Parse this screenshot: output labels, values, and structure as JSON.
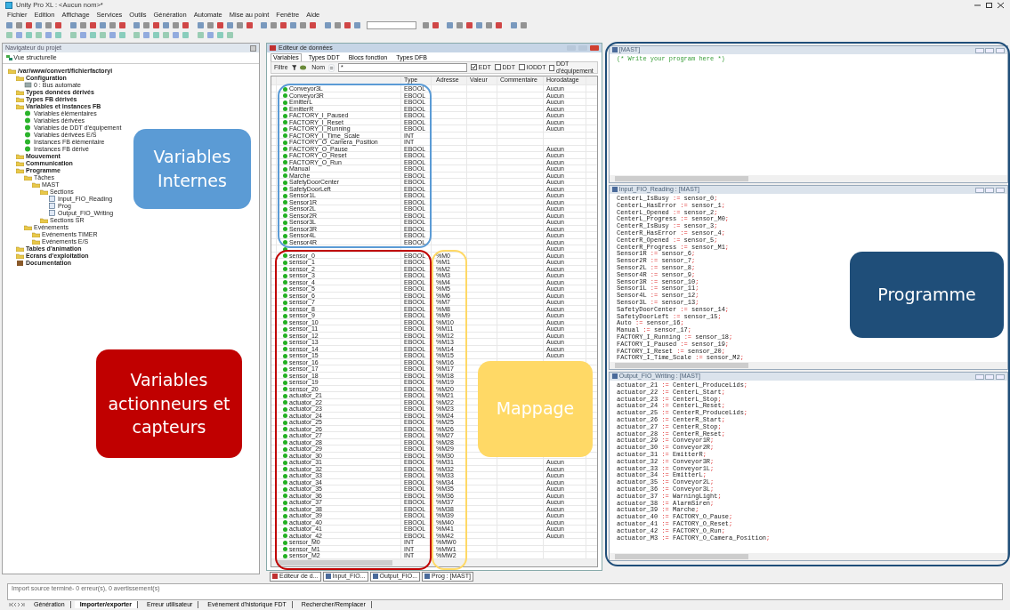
{
  "window": {
    "title": "Unity Pro XL : <Aucun nom>*"
  },
  "menu": [
    "Fichier",
    "Edition",
    "Affichage",
    "Services",
    "Outils",
    "Génération",
    "Automate",
    "Mise au point",
    "Fenêtre",
    "Aide"
  ],
  "project_browser": {
    "title": "Navigateur du projet",
    "view_tab": "Vue structurelle",
    "tree": [
      {
        "label": "/var/www/convert/fichierfactoryi",
        "kind": "folder",
        "children": [
          {
            "label": "Configuration",
            "kind": "folder",
            "children": [
              {
                "label": "0 : Bus automate",
                "kind": "device"
              }
            ]
          },
          {
            "label": "Types données dérivés",
            "kind": "folder"
          },
          {
            "label": "Types FB dérivés",
            "kind": "folder"
          },
          {
            "label": "Variables et instances FB",
            "kind": "folder",
            "children": [
              {
                "label": "Variables élémentaires",
                "kind": "variable"
              },
              {
                "label": "Variables dérivées",
                "kind": "variable"
              },
              {
                "label": "Variables de DDT d'équipement",
                "kind": "variable"
              },
              {
                "label": "Variables dérivées E/S",
                "kind": "variable"
              },
              {
                "label": "Instances FB élémentaire",
                "kind": "variable"
              },
              {
                "label": "Instances FB dérivé",
                "kind": "variable"
              }
            ]
          },
          {
            "label": "Mouvement",
            "kind": "folder"
          },
          {
            "label": "Communication",
            "kind": "folder"
          },
          {
            "label": "Programme",
            "kind": "folder",
            "children": [
              {
                "label": "Tâches",
                "kind": "folder",
                "children": [
                  {
                    "label": "MAST",
                    "kind": "folder",
                    "children": [
                      {
                        "label": "Sections",
                        "kind": "folder",
                        "children": [
                          {
                            "label": "Input_FIO_Reading",
                            "kind": "section"
                          },
                          {
                            "label": "Prog",
                            "kind": "section"
                          },
                          {
                            "label": "Output_FIO_Writing",
                            "kind": "section"
                          }
                        ]
                      },
                      {
                        "label": "Sections SR",
                        "kind": "folder"
                      }
                    ]
                  }
                ]
              },
              {
                "label": "Evénements",
                "kind": "folder",
                "children": [
                  {
                    "label": "Evénements TIMER",
                    "kind": "folder"
                  },
                  {
                    "label": "Evénements E/S",
                    "kind": "folder"
                  }
                ]
              }
            ]
          },
          {
            "label": "Tables d'animation",
            "kind": "folder"
          },
          {
            "label": "Ecrans d'exploitation",
            "kind": "folder"
          },
          {
            "label": "Documentation",
            "kind": "document"
          }
        ]
      }
    ]
  },
  "data_editor": {
    "title": "Editeur de données",
    "tabs": [
      {
        "label": "Variables",
        "selected": true
      },
      {
        "label": "Types DDT",
        "selected": false
      },
      {
        "label": "Blocs fonction",
        "selected": false
      },
      {
        "label": "Types DFB",
        "selected": false
      }
    ],
    "filter": {
      "label": "Filtre",
      "name_label": "Nom",
      "operator": "=",
      "value": "*",
      "options": [
        {
          "label": "EDT",
          "checked": true
        },
        {
          "label": "DDT",
          "checked": false
        },
        {
          "label": "IODDT",
          "checked": false
        },
        {
          "label": "DDT d'équipement",
          "checked": false
        }
      ]
    },
    "columns": [
      "Type",
      "Adresse",
      "Valeur",
      "Commentaire",
      "Horodatage"
    ],
    "rows": [
      {
        "name": "Conveyor3L",
        "type": "EBOOL",
        "timestamp": "Aucun"
      },
      {
        "name": "Conveyor3R",
        "type": "EBOOL",
        "timestamp": "Aucun"
      },
      {
        "name": "EmitterL",
        "type": "EBOOL",
        "timestamp": "Aucun"
      },
      {
        "name": "EmitterR",
        "type": "EBOOL",
        "timestamp": "Aucun"
      },
      {
        "name": "FACTORY_I_Paused",
        "type": "EBOOL",
        "timestamp": "Aucun"
      },
      {
        "name": "FACTORY_I_Reset",
        "type": "EBOOL",
        "timestamp": "Aucun"
      },
      {
        "name": "FACTORY_I_Running",
        "type": "EBOOL",
        "timestamp": "Aucun"
      },
      {
        "name": "FACTORY_I_Time_Scale",
        "type": "INT"
      },
      {
        "name": "FACTORY_O_Camera_Position",
        "type": "INT"
      },
      {
        "name": "FACTORY_O_Pause",
        "type": "EBOOL",
        "timestamp": "Aucun"
      },
      {
        "name": "FACTORY_O_Reset",
        "type": "EBOOL",
        "timestamp": "Aucun"
      },
      {
        "name": "FACTORY_O_Run",
        "type": "EBOOL",
        "timestamp": "Aucun"
      },
      {
        "name": "Manual",
        "type": "EBOOL",
        "timestamp": "Aucun"
      },
      {
        "name": "Marche",
        "type": "EBOOL",
        "timestamp": "Aucun"
      },
      {
        "name": "SafetyDoorCenter",
        "type": "EBOOL",
        "timestamp": "Aucun"
      },
      {
        "name": "SafetyDoorLeft",
        "type": "EBOOL",
        "timestamp": "Aucun"
      },
      {
        "name": "Sensor1L",
        "type": "EBOOL",
        "timestamp": "Aucun"
      },
      {
        "name": "Sensor1R",
        "type": "EBOOL",
        "timestamp": "Aucun"
      },
      {
        "name": "Sensor2L",
        "type": "EBOOL",
        "timestamp": "Aucun"
      },
      {
        "name": "Sensor2R",
        "type": "EBOOL",
        "timestamp": "Aucun"
      },
      {
        "name": "Sensor3L",
        "type": "EBOOL",
        "timestamp": "Aucun"
      },
      {
        "name": "Sensor3R",
        "type": "EBOOL",
        "timestamp": "Aucun"
      },
      {
        "name": "Sensor4L",
        "type": "EBOOL",
        "timestamp": "Aucun"
      },
      {
        "name": "Sensor4R",
        "type": "EBOOL",
        "timestamp": "Aucun"
      },
      {
        "timestamp": "Aucun"
      },
      {
        "name": "sensor_0",
        "type": "EBOOL",
        "address": "%M0",
        "timestamp": "Aucun"
      },
      {
        "name": "sensor_1",
        "type": "EBOOL",
        "address": "%M1",
        "timestamp": "Aucun"
      },
      {
        "name": "sensor_2",
        "type": "EBOOL",
        "address": "%M2",
        "timestamp": "Aucun"
      },
      {
        "name": "sensor_3",
        "type": "EBOOL",
        "address": "%M3",
        "timestamp": "Aucun"
      },
      {
        "name": "sensor_4",
        "type": "EBOOL",
        "address": "%M4",
        "timestamp": "Aucun"
      },
      {
        "name": "sensor_5",
        "type": "EBOOL",
        "address": "%M5",
        "timestamp": "Aucun"
      },
      {
        "name": "sensor_6",
        "type": "EBOOL",
        "address": "%M6",
        "timestamp": "Aucun"
      },
      {
        "name": "sensor_7",
        "type": "EBOOL",
        "address": "%M7",
        "timestamp": "Aucun"
      },
      {
        "name": "sensor_8",
        "type": "EBOOL",
        "address": "%M8",
        "timestamp": "Aucun"
      },
      {
        "name": "sensor_9",
        "type": "EBOOL",
        "address": "%M9",
        "timestamp": "Aucun"
      },
      {
        "name": "sensor_10",
        "type": "EBOOL",
        "address": "%M10",
        "timestamp": "Aucun"
      },
      {
        "name": "sensor_11",
        "type": "EBOOL",
        "address": "%M11",
        "timestamp": "Aucun"
      },
      {
        "name": "sensor_12",
        "type": "EBOOL",
        "address": "%M12",
        "timestamp": "Aucun"
      },
      {
        "name": "sensor_13",
        "type": "EBOOL",
        "address": "%M13",
        "timestamp": "Aucun"
      },
      {
        "name": "sensor_14",
        "type": "EBOOL",
        "address": "%M14",
        "timestamp": "Aucun"
      },
      {
        "name": "sensor_15",
        "type": "EBOOL",
        "address": "%M15",
        "timestamp": "Aucun"
      },
      {
        "name": "sensor_16",
        "type": "EBOOL",
        "address": "%M16"
      },
      {
        "name": "sensor_17",
        "type": "EBOOL",
        "address": "%M17"
      },
      {
        "name": "sensor_18",
        "type": "EBOOL",
        "address": "%M18"
      },
      {
        "name": "sensor_19",
        "type": "EBOOL",
        "address": "%M19"
      },
      {
        "name": "sensor_20",
        "type": "EBOOL",
        "address": "%M20"
      },
      {
        "name": "actuator_21",
        "type": "EBOOL",
        "address": "%M21"
      },
      {
        "name": "actuator_22",
        "type": "EBOOL",
        "address": "%M22"
      },
      {
        "name": "actuator_23",
        "type": "EBOOL",
        "address": "%M23"
      },
      {
        "name": "actuator_24",
        "type": "EBOOL",
        "address": "%M24"
      },
      {
        "name": "actuator_25",
        "type": "EBOOL",
        "address": "%M25"
      },
      {
        "name": "actuator_26",
        "type": "EBOOL",
        "address": "%M26"
      },
      {
        "name": "actuator_27",
        "type": "EBOOL",
        "address": "%M27"
      },
      {
        "name": "actuator_28",
        "type": "EBOOL",
        "address": "%M28"
      },
      {
        "name": "actuator_29",
        "type": "EBOOL",
        "address": "%M29"
      },
      {
        "name": "actuator_30",
        "type": "EBOOL",
        "address": "%M30"
      },
      {
        "name": "actuator_31",
        "type": "EBOOL",
        "address": "%M31",
        "timestamp": "Aucun"
      },
      {
        "name": "actuator_32",
        "type": "EBOOL",
        "address": "%M32",
        "timestamp": "Aucun"
      },
      {
        "name": "actuator_33",
        "type": "EBOOL",
        "address": "%M33",
        "timestamp": "Aucun"
      },
      {
        "name": "actuator_34",
        "type": "EBOOL",
        "address": "%M34",
        "timestamp": "Aucun"
      },
      {
        "name": "actuator_35",
        "type": "EBOOL",
        "address": "%M35",
        "timestamp": "Aucun"
      },
      {
        "name": "actuator_36",
        "type": "EBOOL",
        "address": "%M36",
        "timestamp": "Aucun"
      },
      {
        "name": "actuator_37",
        "type": "EBOOL",
        "address": "%M37",
        "timestamp": "Aucun"
      },
      {
        "name": "actuator_38",
        "type": "EBOOL",
        "address": "%M38",
        "timestamp": "Aucun"
      },
      {
        "name": "actuator_39",
        "type": "EBOOL",
        "address": "%M39",
        "timestamp": "Aucun"
      },
      {
        "name": "actuator_40",
        "type": "EBOOL",
        "address": "%M40",
        "timestamp": "Aucun"
      },
      {
        "name": "actuator_41",
        "type": "EBOOL",
        "address": "%M41",
        "timestamp": "Aucun"
      },
      {
        "name": "actuator_42",
        "type": "EBOOL",
        "address": "%M42",
        "timestamp": "Aucun"
      },
      {
        "name": "sensor_M0",
        "type": "INT",
        "address": "%MW0"
      },
      {
        "name": "sensor_M1",
        "type": "INT",
        "address": "%MW1"
      },
      {
        "name": "sensor_M2",
        "type": "INT",
        "address": "%MW2"
      }
    ]
  },
  "editors": [
    {
      "title": "[MAST]",
      "kind": "comment",
      "lines": [
        "(* Write your program here *)"
      ]
    },
    {
      "title": "Input_FIO_Reading : [MAST]",
      "kind": "code",
      "lines": [
        "CenterL_IsBusy := sensor_0;",
        "CenterL_HasError := sensor_1;",
        "CenterL_Opened := sensor_2;",
        "CenterL_Progress := sensor_M0;",
        "CenterR_IsBusy := sensor_3;",
        "CenterR_HasError := sensor_4;",
        "CenterR_Opened := sensor_5;",
        "CenterR_Progress := sensor_M1;",
        "Sensor1R := sensor_6;",
        "Sensor2R := sensor_7;",
        "Sensor2L := sensor_8;",
        "Sensor4R := sensor_9;",
        "Sensor3R := sensor_10;",
        "Sensor1L := sensor_11;",
        "Sensor4L := sensor_12;",
        "Sensor3L := sensor_13;",
        "SafetyDoorCenter := sensor_14;",
        "SafetyDoorLeft := sensor_15;",
        "Auto := sensor_16;",
        "Manual := sensor_17;",
        "FACTORY_I_Running := sensor_18;",
        "FACTORY_I_Paused := sensor_19;",
        "FACTORY_I_Reset := sensor_20;",
        "FACTORY_I_Time_Scale := sensor_M2;"
      ]
    },
    {
      "title": "Output_FIO_Writing : [MAST]",
      "kind": "code",
      "lines": [
        "actuator_21 := CenterL_ProduceLids;",
        "actuator_22 := CenterL_Start;",
        "actuator_23 := CenterL_Stop;",
        "actuator_24 := CenterL_Reset;",
        "actuator_25 := CenterR_ProduceLids;",
        "actuator_26 := CenterR_Start;",
        "actuator_27 := CenterR_Stop;",
        "actuator_28 := CenterR_Reset;",
        "actuator_29 := Conveyor1R;",
        "actuator_30 := Conveyor2R;",
        "actuator_31 := EmitterR;",
        "actuator_32 := Conveyor3R;",
        "actuator_33 := Conveyor1L;",
        "actuator_34 := EmitterL;",
        "actuator_35 := Conveyor2L;",
        "actuator_36 := Conveyor3L;",
        "actuator_37 := WarningLight;",
        "actuator_38 := AlarmSiren;",
        "actuator_39 := Marche;",
        "actuator_40 := FACTORY_O_Pause;",
        "actuator_41 := FACTORY_O_Reset;",
        "actuator_42 := FACTORY_O_Run;",
        "actuator_M3 := FACTORY_O_Camera_Position;"
      ]
    }
  ],
  "window_tabs": [
    "Editeur de d...",
    "Input_FIO...",
    "Output_FIO...",
    "Prog : [MAST]"
  ],
  "output": {
    "message": "Import source terminé- 0 erreur(s), 0 avertissement(s)",
    "tabs": [
      {
        "label": "Génération",
        "selected": false
      },
      {
        "label": "Importer/exporter",
        "selected": true
      },
      {
        "label": "Erreur utilisateur",
        "selected": false
      },
      {
        "label": "Evénement d'historique FDT",
        "selected": false
      },
      {
        "label": "Rechercher/Remplacer",
        "selected": false
      }
    ]
  },
  "annotations": [
    {
      "label": "Variables Internes",
      "color": "#5b9bd5"
    },
    {
      "label": "Variables actionneurs et capteurs",
      "color": "#c00000"
    },
    {
      "label": "Mappage",
      "color": "#ffd966"
    },
    {
      "label": "Programme",
      "color": "#1f4e79"
    }
  ]
}
